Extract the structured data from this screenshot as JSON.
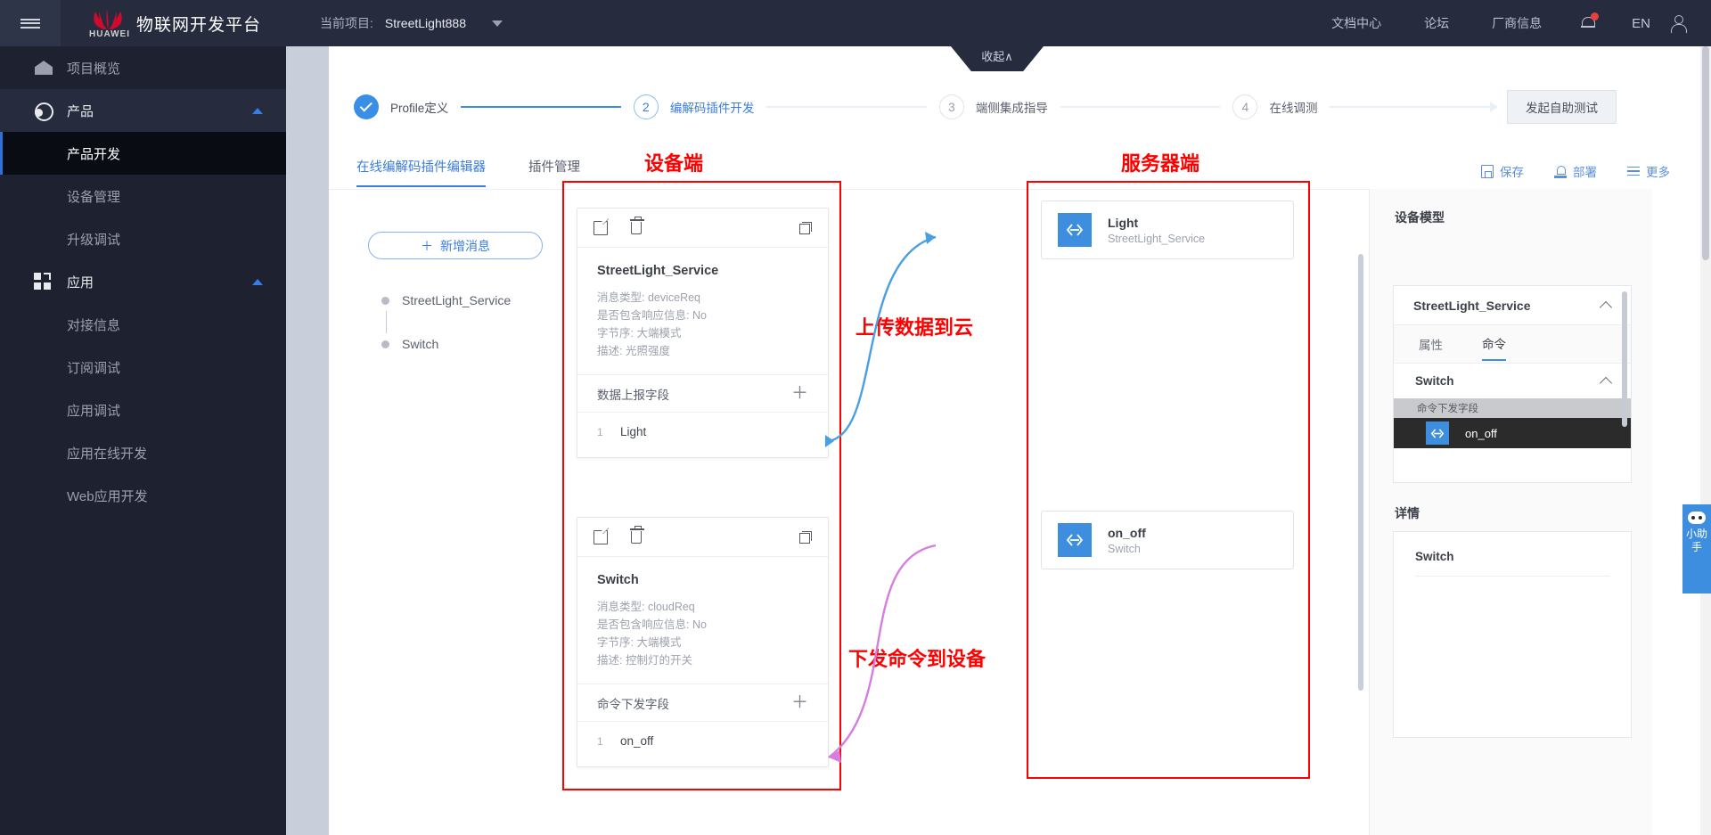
{
  "topbar": {
    "menu_icon": "hamburger-icon",
    "brand_logo_text": "HUAWEI",
    "brand_title": "物联网开发平台",
    "project_label": "当前项目:",
    "project_value": "StreetLight888",
    "nav": [
      {
        "label": "文档中心"
      },
      {
        "label": "论坛"
      },
      {
        "label": "厂商信息"
      }
    ],
    "lang": "EN",
    "notification_icon": "bell-icon",
    "user_icon": "user-avatar-icon"
  },
  "sidebar": {
    "items": [
      {
        "label": "项目概览",
        "type": "group",
        "icon": "home-icon"
      },
      {
        "label": "产品",
        "type": "group",
        "icon": "product-icon",
        "expanded": true
      },
      {
        "label": "产品开发",
        "type": "child",
        "active": true
      },
      {
        "label": "设备管理",
        "type": "child"
      },
      {
        "label": "升级调试",
        "type": "child"
      },
      {
        "label": "应用",
        "type": "group",
        "icon": "app-icon",
        "expanded": true
      },
      {
        "label": "对接信息",
        "type": "child"
      },
      {
        "label": "订阅调试",
        "type": "child"
      },
      {
        "label": "应用调试",
        "type": "child"
      },
      {
        "label": "应用在线开发",
        "type": "child"
      },
      {
        "label": "Web应用开发",
        "type": "child"
      }
    ]
  },
  "collapse_tab": {
    "label": "收起∧"
  },
  "stepper": {
    "steps": [
      {
        "num": "1",
        "label": "Profile定义",
        "state": "done"
      },
      {
        "num": "2",
        "label": "编解码插件开发",
        "state": "current"
      },
      {
        "num": "3",
        "label": "端侧集成指导",
        "state": "todo"
      },
      {
        "num": "4",
        "label": "在线调测",
        "state": "todo"
      }
    ],
    "selftest_button": "发起自助测试"
  },
  "tabs": [
    {
      "label": "在线编解码插件编辑器",
      "active": true
    },
    {
      "label": "插件管理",
      "active": false
    }
  ],
  "toolbar": [
    {
      "label": "保存",
      "icon": "save-icon"
    },
    {
      "label": "部署",
      "icon": "deploy-icon"
    },
    {
      "label": "更多",
      "icon": "more-icon"
    }
  ],
  "message_panel": {
    "add_button": "新增消息",
    "add_icon": "plus-icon",
    "list": [
      {
        "label": "StreetLight_Service"
      },
      {
        "label": "Switch"
      }
    ]
  },
  "annotations": {
    "device_side": "设备端",
    "server_side": "服务器端",
    "upload_to_cloud": "上传数据到云",
    "command_to_device": "下发命令到设备"
  },
  "device_cards": [
    {
      "title": "StreetLight_Service",
      "meta": [
        "消息类型: deviceReq",
        "是否包含响应信息: No",
        "字节序: 大端模式",
        "描述: 光照强度"
      ],
      "section_label": "数据上报字段",
      "add_icon": "plus-icon",
      "fields": [
        {
          "index": "1",
          "name": "Light"
        }
      ],
      "tools": [
        "edit-icon",
        "delete-icon",
        "expand-icon"
      ]
    },
    {
      "title": "Switch",
      "meta": [
        "消息类型: cloudReq",
        "是否包含响应信息: No",
        "字节序: 大端模式",
        "描述: 控制灯的开关"
      ],
      "section_label": "命令下发字段",
      "add_icon": "plus-icon",
      "fields": [
        {
          "index": "1",
          "name": "on_off"
        }
      ],
      "tools": [
        "edit-icon",
        "delete-icon",
        "expand-icon"
      ]
    }
  ],
  "server_cards": [
    {
      "name": "Light",
      "sub": "StreetLight_Service",
      "icon": "mapping-icon"
    },
    {
      "name": "on_off",
      "sub": "Switch",
      "icon": "mapping-icon"
    }
  ],
  "right_panel": {
    "model_title": "设备模型",
    "service_name": "StreetLight_Service",
    "tabs": [
      {
        "label": "属性",
        "active": false
      },
      {
        "label": "命令",
        "active": true
      }
    ],
    "command_group": "Switch",
    "field_group_label": "命令下发字段",
    "field_row": {
      "name": "on_off",
      "icon": "mapping-icon"
    },
    "detail_title": "详情",
    "detail_name": "Switch"
  },
  "assistant": {
    "label": "小助手",
    "icon": "robot-icon"
  },
  "colors": {
    "accent_blue": "#3a8ee6",
    "sidebar_bg": "#1d2130",
    "topbar_bg": "#262b3d",
    "annotation_red": "#ff0000",
    "huawei_red": "#cf0a2c",
    "upload_arrow": "#4a9fe0",
    "command_arrow": "#d57ee0"
  }
}
